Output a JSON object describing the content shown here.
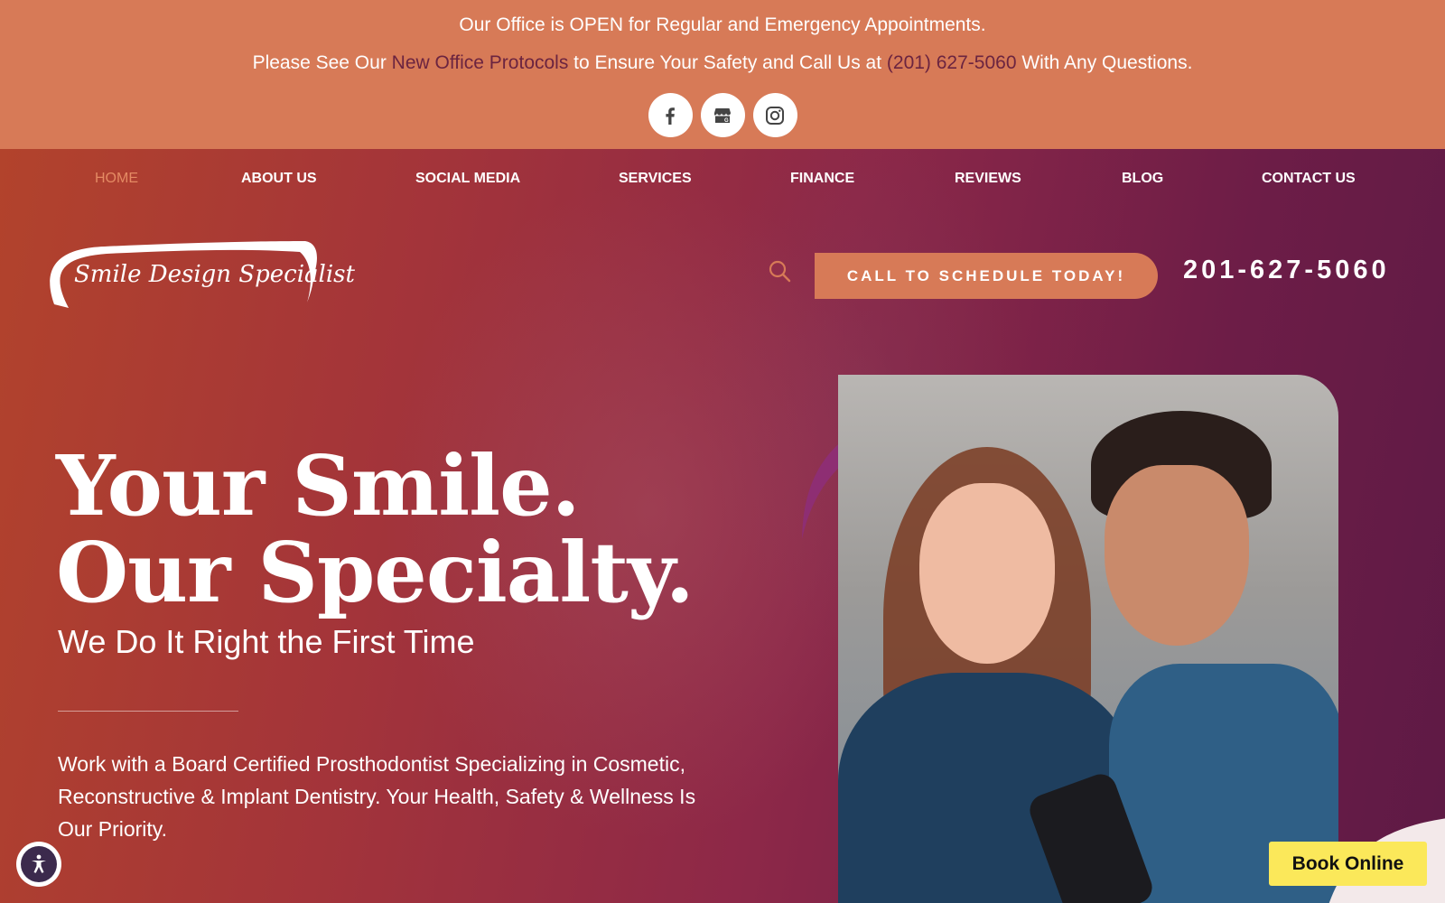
{
  "announcement": {
    "line1": "Our Office is OPEN for Regular and Emergency Appointments.",
    "line2_prefix": "Please See Our ",
    "line2_link": "New Office Protocols",
    "line2_middle": " to Ensure Your Safety and Call Us at ",
    "line2_phone": "(201) 627-5060",
    "line2_suffix": " With Any Questions.",
    "socials": [
      "facebook-icon",
      "google-business-icon",
      "instagram-icon"
    ]
  },
  "nav": {
    "items": [
      {
        "label": "HOME",
        "active": true
      },
      {
        "label": "ABOUT US"
      },
      {
        "label": "SOCIAL MEDIA"
      },
      {
        "label": "SERVICES"
      },
      {
        "label": "FINANCE"
      },
      {
        "label": "REVIEWS"
      },
      {
        "label": "BLOG"
      },
      {
        "label": "CONTACT US"
      }
    ]
  },
  "logo": {
    "text": "Smile Design Specialist"
  },
  "header": {
    "cta_label": "CALL TO SCHEDULE TODAY!",
    "phone": "201-627-5060"
  },
  "hero": {
    "headline_line1": "Your Smile.",
    "headline_line2": "Our Specialty.",
    "subheadline": "We Do It Right the First Time",
    "body": "Work with a Board Certified Prosthodontist Specializing in Cosmetic, Reconstructive & Implant Dentistry. Your Health, Safety & Wellness Is Our Priority."
  },
  "book_online": {
    "label": "Book Online"
  },
  "colors": {
    "accent": "#d77a57",
    "link": "#6b2440",
    "book_button": "#fbe85a"
  }
}
